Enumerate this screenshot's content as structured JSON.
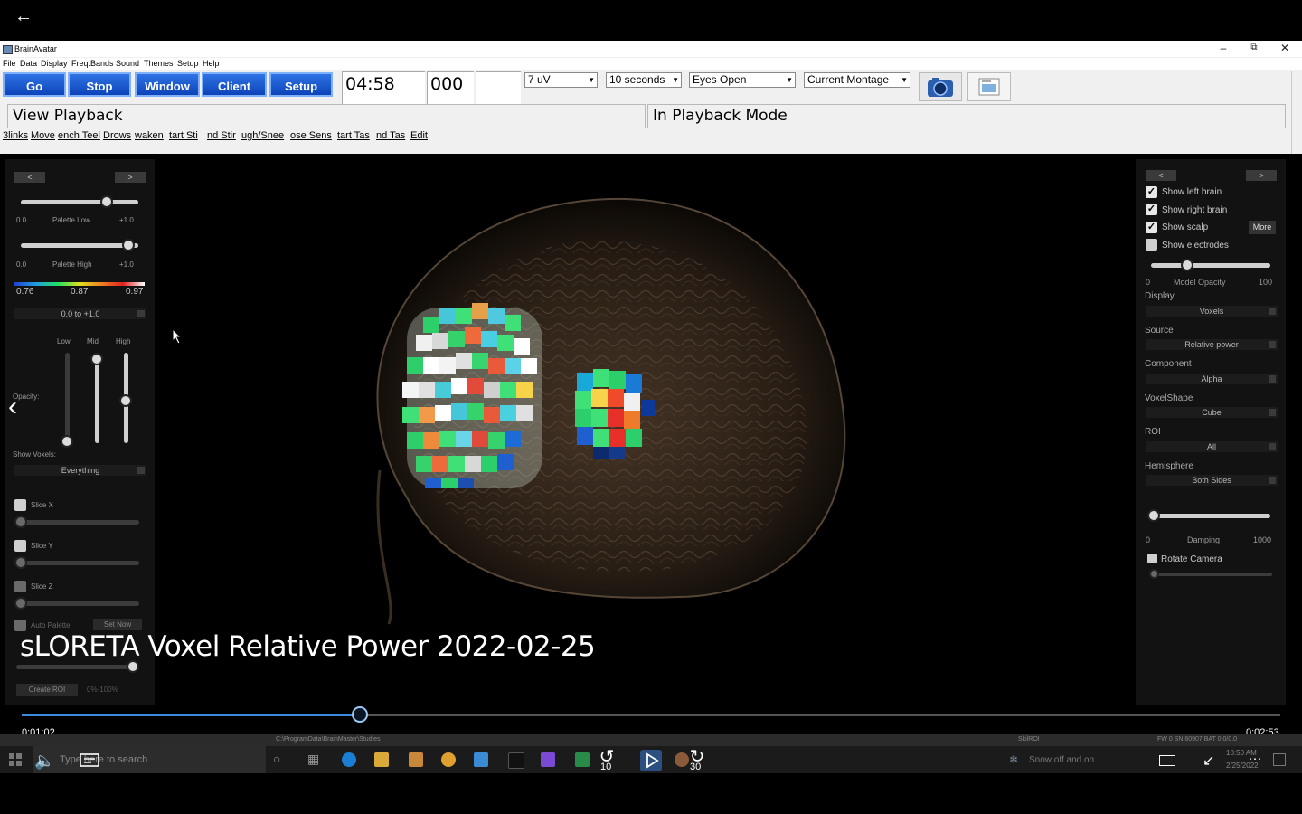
{
  "app": {
    "title": "BrainAvatar",
    "menu": [
      "File",
      "Data",
      "Display",
      "Freq.Bands",
      "Sound",
      "Themes",
      "Setup",
      "Help"
    ]
  },
  "toolbar": {
    "go_label": "Go",
    "stop_label": "Stop",
    "window_label": "Window",
    "client_label": "Client",
    "setup_label": "Setup",
    "timer": "04:58",
    "counter": "000",
    "scale_value": "7 uV",
    "duration_value": "10 seconds",
    "condition_value": "Eyes Open",
    "montage_value": "Current Montage"
  },
  "status": {
    "left": "View Playback",
    "right": "In Playback Mode"
  },
  "events": [
    "3links",
    "Movei",
    "ench Teel",
    "Drows",
    "waken",
    "tart Sti",
    "nd Stir",
    "ugh/Snee",
    "ose Sens",
    "tart Tas",
    "nd Tas",
    "Edit"
  ],
  "left_panel": {
    "nav_prev": "<",
    "nav_next": ">",
    "palette_low": {
      "min": "0.0",
      "label": "Palette Low",
      "max": "+1.0",
      "value": 0.7
    },
    "palette_high": {
      "min": "0.0",
      "label": "Palette High",
      "max": "+1.0",
      "value": 0.92
    },
    "colorbar_ticks": [
      "0.76",
      "0.87",
      "0.97"
    ],
    "range_dropdown": "0.0 to +1.0",
    "opacity_labels": {
      "low": "Low",
      "mid": "Mid",
      "high": "High",
      "title": "Opacity:"
    },
    "show_voxels_label": "Show Voxels:",
    "show_voxels_value": "Everything",
    "slice_x": "Slice X",
    "slice_y": "Slice Y",
    "slice_z": "Slice Z",
    "auto_palette": "Auto Palette",
    "set_now": "Set Now",
    "create_roi": "Create ROI",
    "roi_range": "0%-100%"
  },
  "right_panel": {
    "nav_prev": "<",
    "nav_next": ">",
    "show_left_brain": "Show left brain",
    "show_right_brain": "Show right brain",
    "show_scalp": "Show scalp",
    "more": "More",
    "show_electrodes": "Show electrodes",
    "opacity": {
      "min": "0",
      "label": "Model Opacity",
      "max": "100",
      "value": 0.26
    },
    "display_label": "Display",
    "display_value": "Voxels",
    "source_label": "Source",
    "source_value": "Relative power",
    "component_label": "Component",
    "component_value": "Alpha",
    "voxelshape_label": "VoxelShape",
    "voxelshape_value": "Cube",
    "roi_label": "ROI",
    "roi_value": "All",
    "hemisphere_label": "Hemisphere",
    "hemisphere_value": "Both Sides",
    "damping": {
      "min": "0",
      "label": "Damping",
      "max": "1000",
      "value": 0.0
    },
    "rotate_camera": "Rotate Camera"
  },
  "video": {
    "caption": "sLORETA Voxel Relative Power 2022-02-25",
    "current_time": "0:01:02",
    "total_time": "0:02:53",
    "progress": 0.269,
    "skip_back": "10",
    "skip_forward": "30"
  },
  "taskbar": {
    "search_placeholder": "Type here to search",
    "status_text": "SkilROI",
    "weather": "Snow off and on",
    "serial": "FW 0 SN 60907 BAT 0.0/0.0",
    "clock_time": "10:50 AM",
    "clock_date": "2/25/2022",
    "path": "C:\\ProgramData\\BrainMaster\\Studies"
  },
  "colors": {
    "accent_blue": "#1a5fd6",
    "progress": "#3a8bdc"
  }
}
